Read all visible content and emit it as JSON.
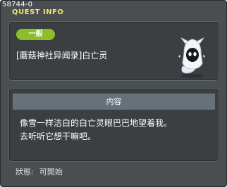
{
  "window": {
    "quest_id": "58744-0",
    "title": "QUEST INFO"
  },
  "quest": {
    "category": "一般",
    "name": "[蘑菇神社异闻录]白亡灵",
    "npc_icon": "white-ghost-npc-icon"
  },
  "content": {
    "header": "内容",
    "lines": [
      "像雪一样洁白的白亡灵眼巴巴地望着我。",
      "去听听它想干嘛吧。"
    ]
  },
  "status": {
    "label": "狀態:",
    "value": "可開始"
  },
  "colors": {
    "background": "#4a4e51",
    "panel": "#3b3f42",
    "title": "#f2e36c",
    "badge": "#8cbd2c",
    "section_header": "#66727a"
  }
}
